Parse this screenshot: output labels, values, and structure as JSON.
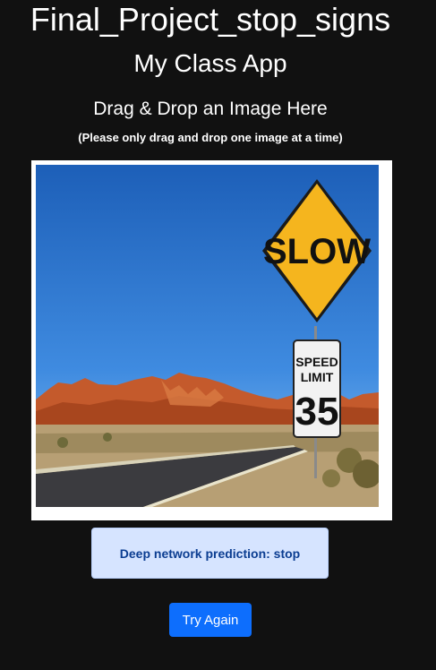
{
  "header": {
    "project_title": "Final_Project_stop_signs",
    "app_title": "My Class App"
  },
  "upload": {
    "heading": "Drag & Drop an Image Here",
    "subtitle": "(Please only drag and drop one image at a time)"
  },
  "uploaded_image": {
    "sign_text": "SLOW",
    "speed_sign_line1": "SPEED",
    "speed_sign_line2": "LIMIT",
    "speed_sign_number": "35"
  },
  "result": {
    "prediction_text": "Deep network prediction: stop"
  },
  "actions": {
    "try_again_label": "Try Again"
  },
  "colors": {
    "background": "#111111",
    "prediction_bg": "#d6e4ff",
    "prediction_text": "#0b3d91",
    "button_primary": "#0d6efd"
  }
}
